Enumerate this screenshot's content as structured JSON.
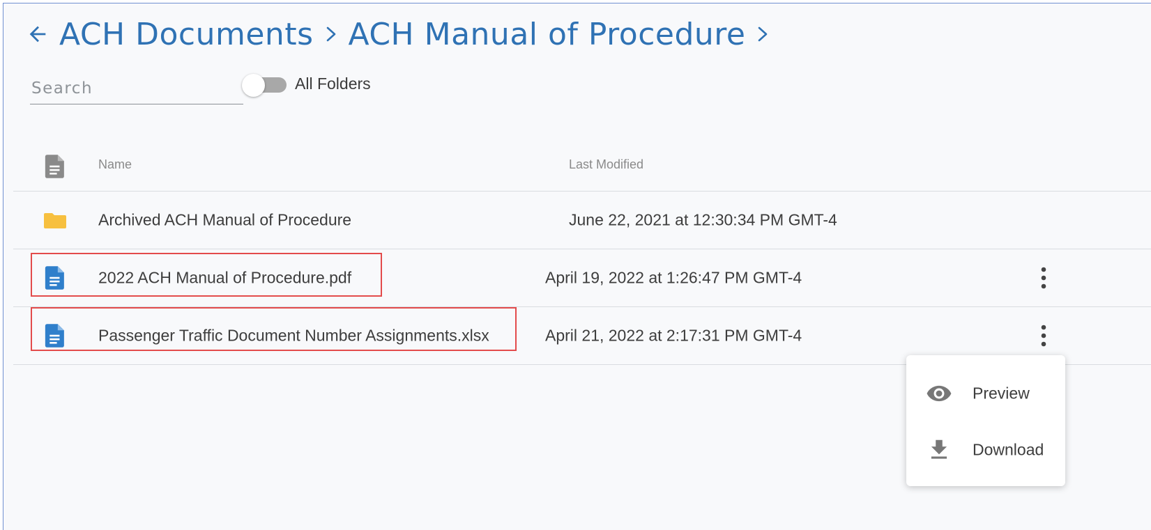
{
  "breadcrumb": {
    "items": [
      "ACH Documents",
      "ACH Manual of Procedure"
    ]
  },
  "search": {
    "placeholder": "Search",
    "value": ""
  },
  "toggle": {
    "label": "All Folders",
    "on": false
  },
  "table": {
    "headers": {
      "name": "Name",
      "last_modified": "Last Modified"
    },
    "rows": [
      {
        "type": "folder",
        "name": "Archived ACH Manual of Procedure",
        "last_modified": "June 22, 2021 at 12:30:34 PM GMT-4",
        "highlighted": false
      },
      {
        "type": "file",
        "name": "2022 ACH Manual of Procedure.pdf",
        "last_modified": "April 19, 2022 at 1:26:47 PM GMT-4",
        "highlighted": true
      },
      {
        "type": "file",
        "name": "Passenger Traffic Document Number Assignments.xlsx",
        "last_modified": "April 21, 2022 at 2:17:31 PM GMT-4",
        "highlighted": true
      }
    ]
  },
  "context_menu": {
    "items": [
      {
        "label": "Preview",
        "icon": "eye-icon"
      },
      {
        "label": "Download",
        "icon": "download-icon"
      }
    ]
  },
  "colors": {
    "accent": "#2f72b4",
    "file_icon": "#2f7fcb",
    "folder_icon": "#f7c03f",
    "highlight_border": "#e34b4b",
    "header_icon": "#8a8a8a"
  }
}
